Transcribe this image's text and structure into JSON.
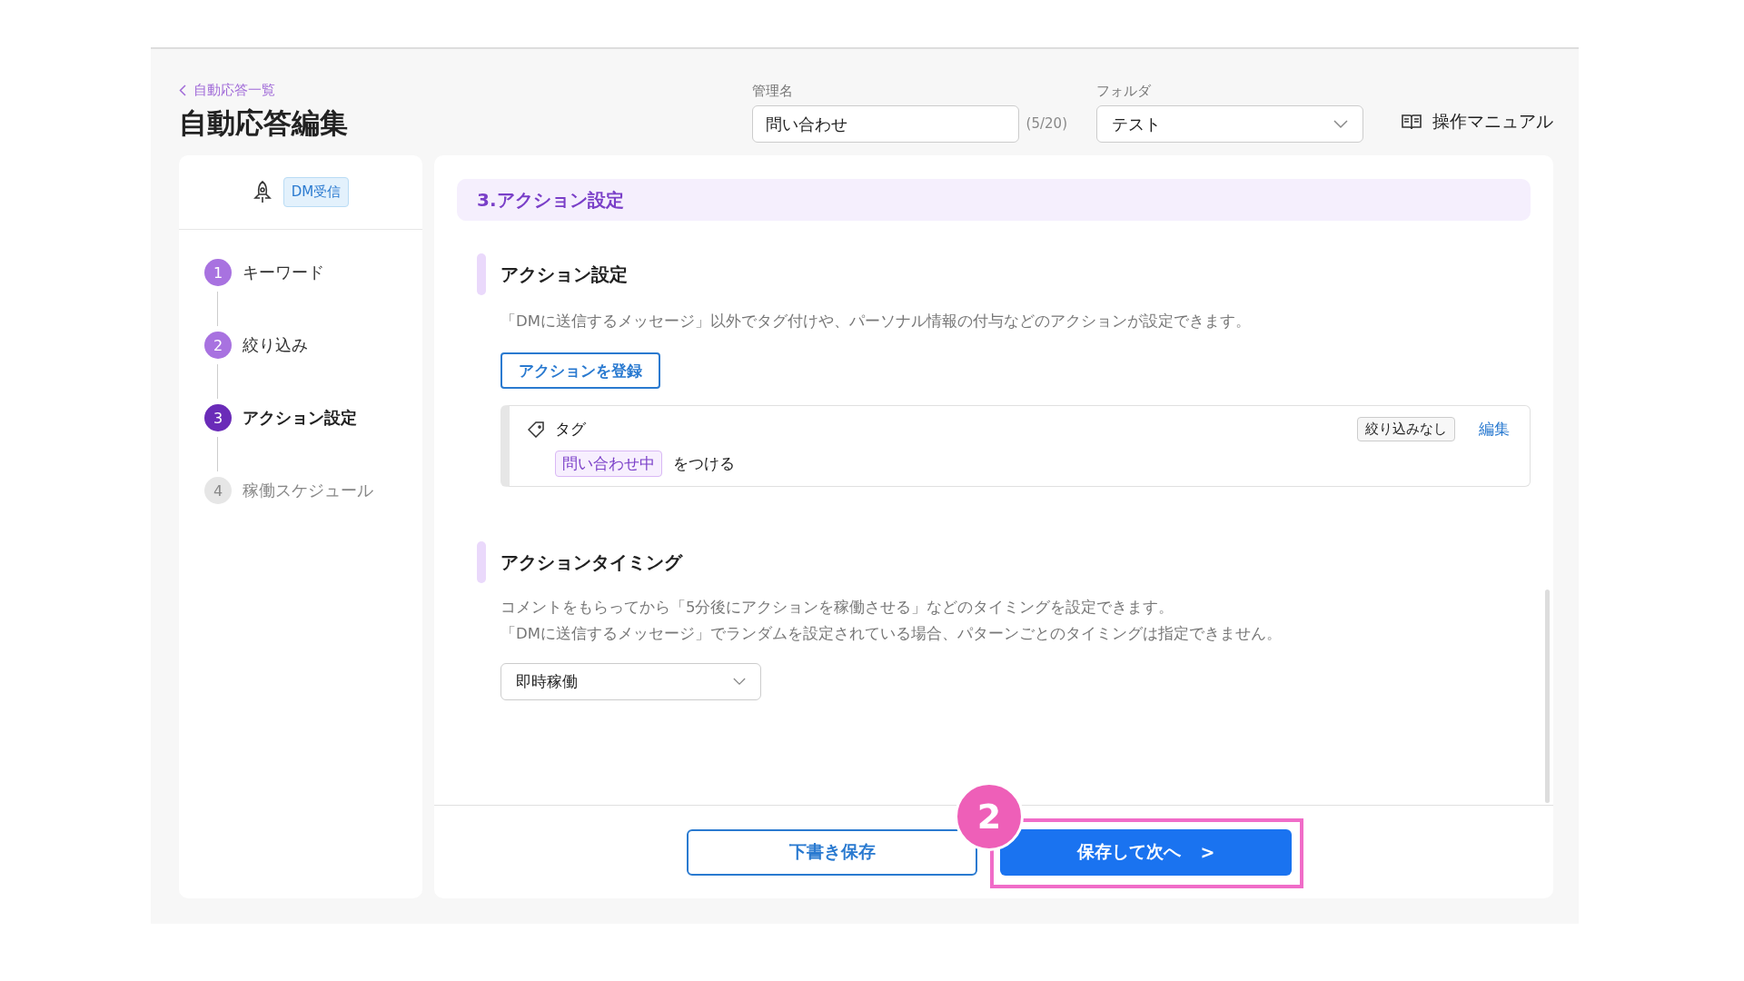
{
  "header": {
    "back_link": "自動応答一覧",
    "title": "自動応答編集",
    "name_field": {
      "label": "管理名",
      "value": "問い合わせ",
      "counter": "(5/20)"
    },
    "folder_select": {
      "label": "フォルダ",
      "value": "テスト"
    },
    "manual_link": "操作マニュアル"
  },
  "sidebar": {
    "trigger_badge": "DM受信",
    "steps": [
      {
        "number": "1",
        "label": "キーワード",
        "kind": "done"
      },
      {
        "number": "2",
        "label": "絞り込み",
        "kind": "done"
      },
      {
        "number": "3",
        "label": "アクション設定",
        "kind": "current"
      },
      {
        "number": "4",
        "label": "稼働スケジュール",
        "kind": "upcoming"
      }
    ]
  },
  "main": {
    "section_title": "3.アクション設定",
    "action_settings": {
      "title": "アクション設定",
      "description": "「DMに送信するメッセージ」以外でタグ付けや、パーソナル情報の付与などのアクションが設定できます。",
      "register_button": "アクションを登録",
      "actions": [
        {
          "type": "タグ",
          "tag": "問い合わせ中",
          "suffix": "をつける",
          "filter_badge": "絞り込みなし",
          "edit_link": "編集"
        }
      ]
    },
    "action_timing": {
      "title": "アクションタイミング",
      "description_lines": [
        "コメントをもらってから「5分後にアクションを稼働させる」などのタイミングを設定できます。",
        "「DMに送信するメッセージ」でランダムを設定されている場合、パターンごとのタイミングは指定できません。"
      ],
      "select_value": "即時稼働"
    }
  },
  "footer": {
    "draft_button": "下書き保存",
    "next_button": "保存して次へ",
    "next_arrow": ">"
  },
  "annotation": {
    "number": "2"
  }
}
